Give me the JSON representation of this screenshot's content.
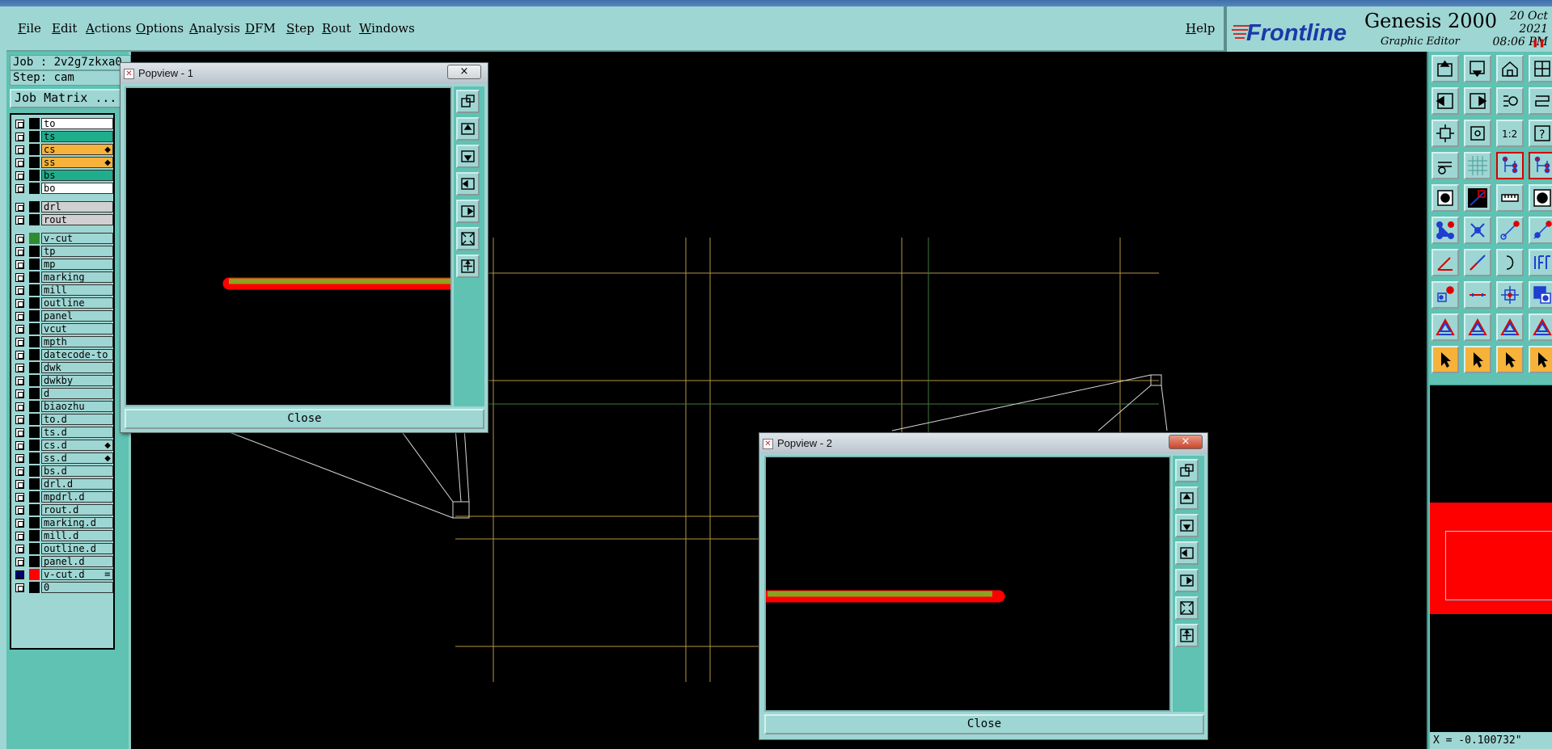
{
  "menubar": {
    "items": [
      "File",
      "Edit",
      "Actions",
      "Options",
      "Analysis",
      "DFM",
      "Step",
      "Rout",
      "Windows"
    ],
    "help": "Help"
  },
  "brand": {
    "logo": "Frontline",
    "product": "Genesis 2000",
    "subtitle": "Graphic Editor",
    "date": "20 Oct 2021",
    "time": "08:06 PM"
  },
  "left_panel": {
    "job": "Job : 2v2g7zkxa0",
    "step": "Step: cam",
    "job_matrix_button": "Job Matrix ...",
    "layers": [
      {
        "name": "to",
        "color": "#ffffff"
      },
      {
        "name": "ts",
        "color": "#1fae8c"
      },
      {
        "name": "cs",
        "color": "#f6b23a",
        "mark": "◆"
      },
      {
        "name": "ss",
        "color": "#f6b23a",
        "mark": "◆"
      },
      {
        "name": "bs",
        "color": "#1fae8c"
      },
      {
        "name": "bo",
        "color": "#ffffff"
      },
      {
        "gap": true
      },
      {
        "name": "drl",
        "color": "#d0d0d0"
      },
      {
        "name": "rout",
        "color": "#d0d0d0"
      },
      {
        "gap": true
      },
      {
        "name": "v-cut",
        "color": "#9ed6d3",
        "swatch": "#2e8b2e"
      },
      {
        "name": "tp",
        "color": "#9ed6d3"
      },
      {
        "name": "mp",
        "color": "#9ed6d3"
      },
      {
        "name": "marking",
        "color": "#9ed6d3"
      },
      {
        "name": "mill",
        "color": "#9ed6d3"
      },
      {
        "name": "outline",
        "color": "#9ed6d3"
      },
      {
        "name": "panel",
        "color": "#9ed6d3"
      },
      {
        "name": "vcut",
        "color": "#9ed6d3"
      },
      {
        "name": "mpth",
        "color": "#9ed6d3"
      },
      {
        "name": "datecode-to",
        "color": "#9ed6d3"
      },
      {
        "name": "dwk",
        "color": "#9ed6d3"
      },
      {
        "name": "dwkby",
        "color": "#9ed6d3"
      },
      {
        "name": "d",
        "color": "#9ed6d3"
      },
      {
        "name": "biaozhu",
        "color": "#9ed6d3"
      },
      {
        "name": "to.d",
        "color": "#9ed6d3"
      },
      {
        "name": "ts.d",
        "color": "#9ed6d3"
      },
      {
        "name": "cs.d",
        "color": "#9ed6d3",
        "mark": "◆"
      },
      {
        "name": "ss.d",
        "color": "#9ed6d3",
        "mark": "◆"
      },
      {
        "name": "bs.d",
        "color": "#9ed6d3"
      },
      {
        "name": "drl.d",
        "color": "#9ed6d3"
      },
      {
        "name": "mpdrl.d",
        "color": "#9ed6d3"
      },
      {
        "name": "rout.d",
        "color": "#9ed6d3"
      },
      {
        "name": "marking.d",
        "color": "#9ed6d3"
      },
      {
        "name": "mill.d",
        "color": "#9ed6d3"
      },
      {
        "name": "outline.d",
        "color": "#9ed6d3"
      },
      {
        "name": "panel.d",
        "color": "#9ed6d3"
      },
      {
        "name": "v-cut.d",
        "color": "#9ed6d3",
        "swatch": "#ff0000",
        "active": true,
        "mark": "≡"
      },
      {
        "name": "0",
        "color": "#9ed6d3"
      }
    ]
  },
  "popview1": {
    "title": "Popview - 1",
    "close_label": "Close",
    "close_x": "×"
  },
  "popview2": {
    "title": "Popview - 2",
    "close_label": "Close",
    "close_x": "×"
  },
  "popview_tools": [
    "zoom-window-icon",
    "pan-up-icon",
    "pan-down-icon",
    "pan-left-icon",
    "pan-right-icon",
    "zoom-fit-icon",
    "zoom-home-icon"
  ],
  "coord": "X = -0.100732\"",
  "toolbox_labels": {
    "scale": "1:2",
    "help": "?"
  }
}
